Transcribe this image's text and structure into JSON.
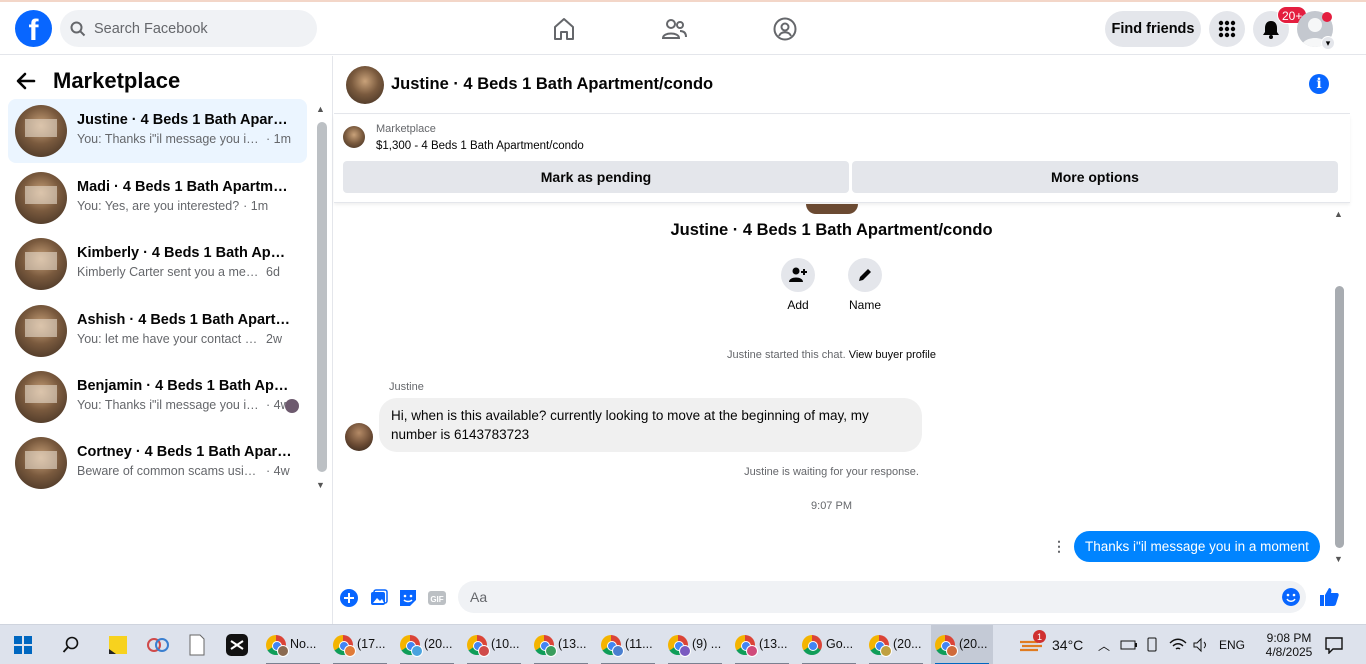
{
  "nav": {
    "search_placeholder": "Search Facebook",
    "find_friends": "Find friends",
    "notif_badge": "20+"
  },
  "sidebar": {
    "title": "Marketplace",
    "conversations": [
      {
        "name": "Justine · 4 Beds 1 Bath Apartme...",
        "preview": "You: Thanks i\"il message you in a ...",
        "time": "· 1m",
        "active": true
      },
      {
        "name": "Madi · 4 Beds 1 Bath Apartment...",
        "preview": "You: Yes, are you interested?",
        "time": "· 1m"
      },
      {
        "name": "Kimberly · 4 Beds 1 Bath Apart...",
        "preview": "Kimberly Carter sent you a messag...",
        "time": "6d"
      },
      {
        "name": "Ashish · 4 Beds 1 Bath Apartme...",
        "preview": "You: let me have your contact nu...",
        "time": "2w"
      },
      {
        "name": "Benjamin · 4 Beds 1 Bath Apar...",
        "preview": "You: Thanks i\"il message you in...",
        "time": "· 4w"
      },
      {
        "name": "Cortney · 4 Beds 1 Bath Apartm...",
        "preview": "Beware of common scams using ...",
        "time": "· 4w"
      }
    ]
  },
  "chat": {
    "header_title": "Justine · 4 Beds 1 Bath Apartment/condo",
    "listing_source": "Marketplace",
    "listing_title": "$1,300 - 4 Beds 1 Bath Apartment/condo",
    "mark_pending": "Mark as pending",
    "more_options": "More options",
    "profile_title": "Justine · 4 Beds 1 Bath Apartment/condo",
    "add_label": "Add",
    "name_label": "Name",
    "started_text": "Justine started this chat.",
    "view_buyer_profile": "View buyer profile",
    "sender_name": "Justine",
    "incoming_message": "Hi, when is this available? currently looking to move at the beginning of may, my number is 6143783723",
    "waiting_text": "Justine is waiting for your response.",
    "timestamp": "9:07 PM",
    "outgoing_message": "Thanks i\"il message you in a moment",
    "composer_placeholder": "Aa"
  },
  "taskbar": {
    "apps": [
      {
        "label": "No...",
        "overlay": "#8b6a50"
      },
      {
        "label": "(17...",
        "overlay": "#e07b39"
      },
      {
        "label": "(20...",
        "overlay": "#4aa3df"
      },
      {
        "label": "(10...",
        "overlay": "#d04a4a"
      },
      {
        "label": "(13...",
        "overlay": "#3a9d5d"
      },
      {
        "label": "(11...",
        "overlay": "#4a7fd0"
      },
      {
        "label": "(9) ...",
        "overlay": "#7a5ac0"
      },
      {
        "label": "(13...",
        "overlay": "#d04a7a"
      },
      {
        "label": "Go...",
        "overlay": ""
      },
      {
        "label": "(20...",
        "overlay": "#c0a040"
      },
      {
        "label": "(20...",
        "overlay": "#d06a3a"
      }
    ],
    "weather_badge": "1",
    "temperature": "34°C",
    "language": "ENG",
    "time": "9:08 PM",
    "date": "4/8/2025"
  },
  "colors": {
    "brand": "#0866ff",
    "outgoing_bubble": "#0084ff",
    "active_conversation": "#ebf5ff"
  }
}
